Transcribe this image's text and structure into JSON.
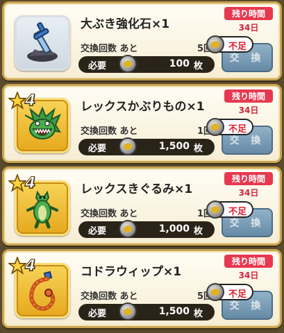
{
  "labels": {
    "remaining_time": "残り時間",
    "exchange_count": "交換回数 あと",
    "required": "必要",
    "unit": "枚",
    "exchange_button": "交 換",
    "shortage": "不足"
  },
  "items": [
    {
      "name": "大ぶき強化石×1",
      "rank": null,
      "remaining_count": "5回",
      "cost": "100",
      "days_left": "34日",
      "icon": "sword-in-stone-icon"
    },
    {
      "name": "レックスかぶりもの×1",
      "rank": "4",
      "remaining_count": "1回",
      "cost": "1,500",
      "days_left": "34日",
      "icon": "dragon-head-icon"
    },
    {
      "name": "レックスきぐるみ×1",
      "rank": "4",
      "remaining_count": "1回",
      "cost": "1,000",
      "days_left": "34日",
      "icon": "dragon-costume-icon"
    },
    {
      "name": "コドラウィップ×1",
      "rank": "4",
      "remaining_count": "5回",
      "cost": "1,500",
      "days_left": "34日",
      "icon": "whip-icon"
    }
  ]
}
